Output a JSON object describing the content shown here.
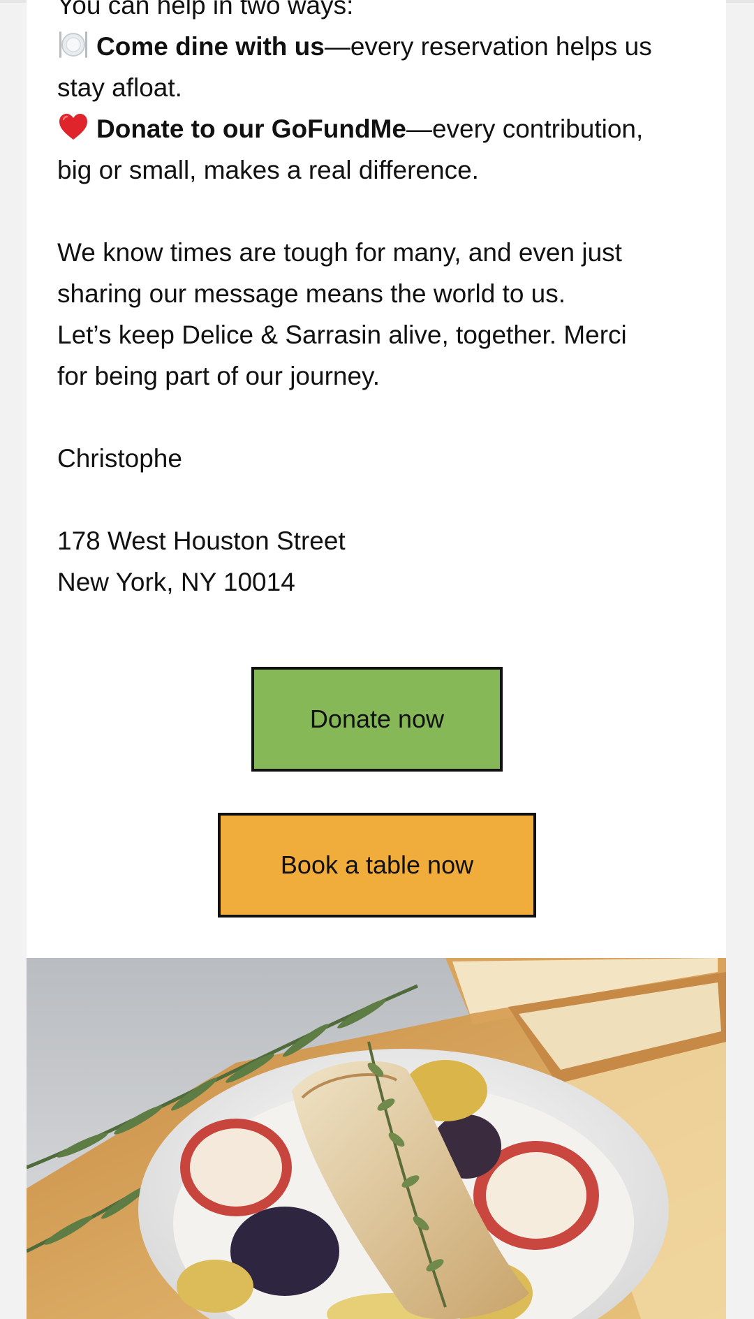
{
  "message": {
    "intro": "You can help in two ways:",
    "way1": {
      "icon": "plate-cutlery-icon",
      "bold": "Come dine with us",
      "rest_line1": "—every reservation helps us",
      "rest_line2": "stay afloat."
    },
    "way2": {
      "icon": "red-heart-icon",
      "bold": "Donate to our GoFundMe",
      "rest_line1": "—every contribution,",
      "rest_line2": "big or small, makes a real difference."
    },
    "paragraph": [
      "We know times are tough for many, and even just",
      "sharing our message means the world to us.",
      "Let’s keep Delice & Sarrasin alive, together. Merci",
      "for being part of our journey."
    ],
    "signature": "Christophe",
    "address": [
      "178 West Houston Street",
      "New York, NY 10014"
    ]
  },
  "buttons": {
    "donate": {
      "label": "Donate now",
      "color": "#86b857"
    },
    "book": {
      "label": "Book a table now",
      "color": "#f0ad3c"
    }
  },
  "photo": {
    "icon": "food-photo"
  }
}
